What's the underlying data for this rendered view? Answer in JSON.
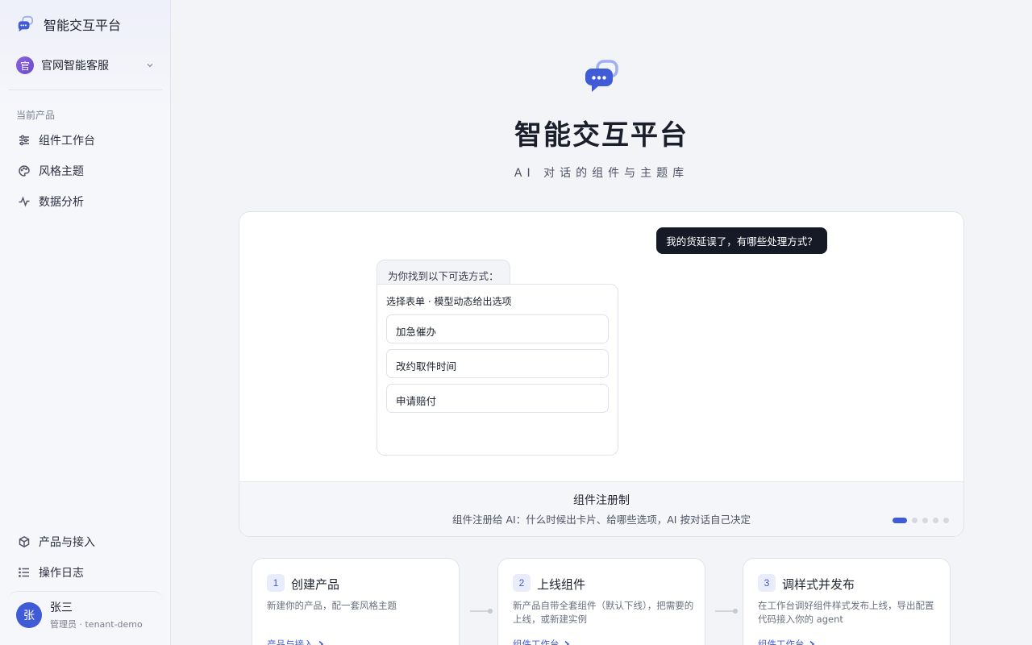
{
  "app": {
    "title": "智能交互平台"
  },
  "sidebar": {
    "product": {
      "avatar_text": "官",
      "name": "官网智能客服"
    },
    "section_label": "当前产品",
    "nav_top": [
      {
        "label": "组件工作台",
        "icon": "sliders-icon"
      },
      {
        "label": "风格主题",
        "icon": "palette-icon"
      },
      {
        "label": "数据分析",
        "icon": "activity-icon"
      }
    ],
    "nav_bottom": [
      {
        "label": "产品与接入",
        "icon": "cube-icon"
      },
      {
        "label": "操作日志",
        "icon": "list-icon"
      }
    ],
    "user": {
      "avatar_text": "张",
      "name": "张三",
      "role": "管理员 · tenant-demo"
    }
  },
  "hero": {
    "title": "智能交互平台",
    "subtitle": "AI 对话的组件与主题库"
  },
  "demo": {
    "user_message": "我的货延误了，有哪些处理方式？",
    "bot_message": "为你找到以下可选方式：",
    "form_title": "选择表单 · 模型动态给出选项",
    "options": [
      "加急催办",
      "改约取件时间",
      "申请赔付"
    ],
    "footer_title": "组件注册制",
    "footer_desc": "组件注册给 AI：什么时候出卡片、给哪些选项，AI 按对话自己决定",
    "carousel": {
      "total": 5,
      "active": 1
    }
  },
  "steps": [
    {
      "num": "1",
      "title": "创建产品",
      "desc": "新建你的产品，配一套风格主题",
      "link": "产品与接入"
    },
    {
      "num": "2",
      "title": "上线组件",
      "desc": "新产品自带全套组件（默认下线），把需要的上线，或新建实例",
      "link": "组件工作台"
    },
    {
      "num": "3",
      "title": "调样式并发布",
      "desc": "在工作台调好组件样式发布上线，导出配置代码接入你的 agent",
      "link": "组件工作台"
    }
  ],
  "colors": {
    "accent": "#3f5bd6",
    "dark_bubble": "#151a26",
    "avatar_purple": "#7a55d8"
  }
}
